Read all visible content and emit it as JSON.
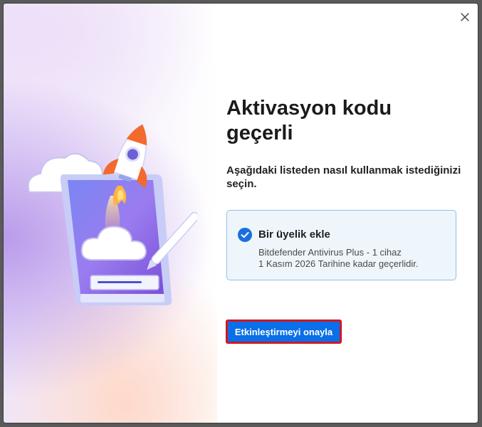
{
  "dialog": {
    "title": "Aktivasyon kodu geçerli",
    "subtitle": "Aşağıdaki listeden nasıl kullanmak istediğinizi seçin.",
    "close_icon": "close-icon",
    "illustration_icon": "rocket-tablet-illustration"
  },
  "option": {
    "selected": true,
    "check_icon": "check-circle-icon",
    "title": "Bir üyelik ekle",
    "product_line": "Bitdefender Antivirus Plus - 1 cihaz",
    "validity_line": "1 Kasım 2026 Tarihine kadar geçerlidir."
  },
  "actions": {
    "confirm_label": "Etkinleştirmeyi onayla"
  },
  "colors": {
    "accent": "#0a6fe8",
    "card_border": "#8fc0e6",
    "card_background": "#eef6fc",
    "highlight_outline": "#d41a26"
  }
}
